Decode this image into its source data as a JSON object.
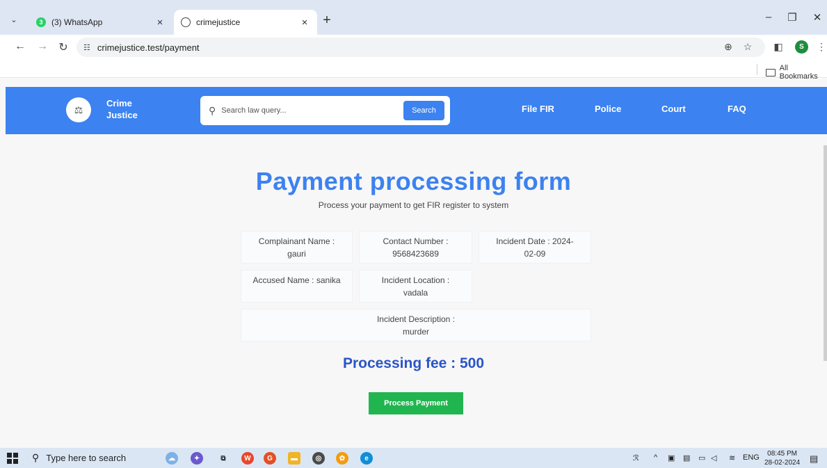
{
  "browser": {
    "tabs": [
      {
        "title": "(3) WhatsApp",
        "badge": "3",
        "active": false
      },
      {
        "title": "crimejustice",
        "active": true
      }
    ],
    "url": "crimejustice.test/payment",
    "profile_initial": "S",
    "bookmarks_label": "All Bookmarks"
  },
  "site": {
    "brand_line1": "Crime",
    "brand_line2": "Justice",
    "search_placeholder": "Search law query...",
    "search_button": "Search",
    "nav": [
      "File FIR",
      "Police",
      "Court",
      "FAQ"
    ]
  },
  "page": {
    "title": "Payment processing form",
    "subtitle": "Process your payment to get FIR register to system",
    "details": {
      "complainant_label": "Complainant Name :",
      "complainant_value": "gauri",
      "contact_label": "Contact Number :",
      "contact_value": "9568423689",
      "incident_date_label": "Incident Date : 2024-",
      "incident_date_value": "02-09",
      "accused": "Accused Name : sanika",
      "location_label": "Incident Location :",
      "location_value": "vadala",
      "description_label": "Incident Description :",
      "description_value": "murder"
    },
    "fee": "Processing fee : 500",
    "pay_button": "Process Payment"
  },
  "taskbar": {
    "search_placeholder": "Type here to search",
    "language": "ENG",
    "time": "08:45 PM",
    "date": "28-02-2024"
  },
  "colors": {
    "brand_blue": "#3c82f0",
    "fee_blue": "#2a55c7",
    "pay_green": "#21b550"
  }
}
